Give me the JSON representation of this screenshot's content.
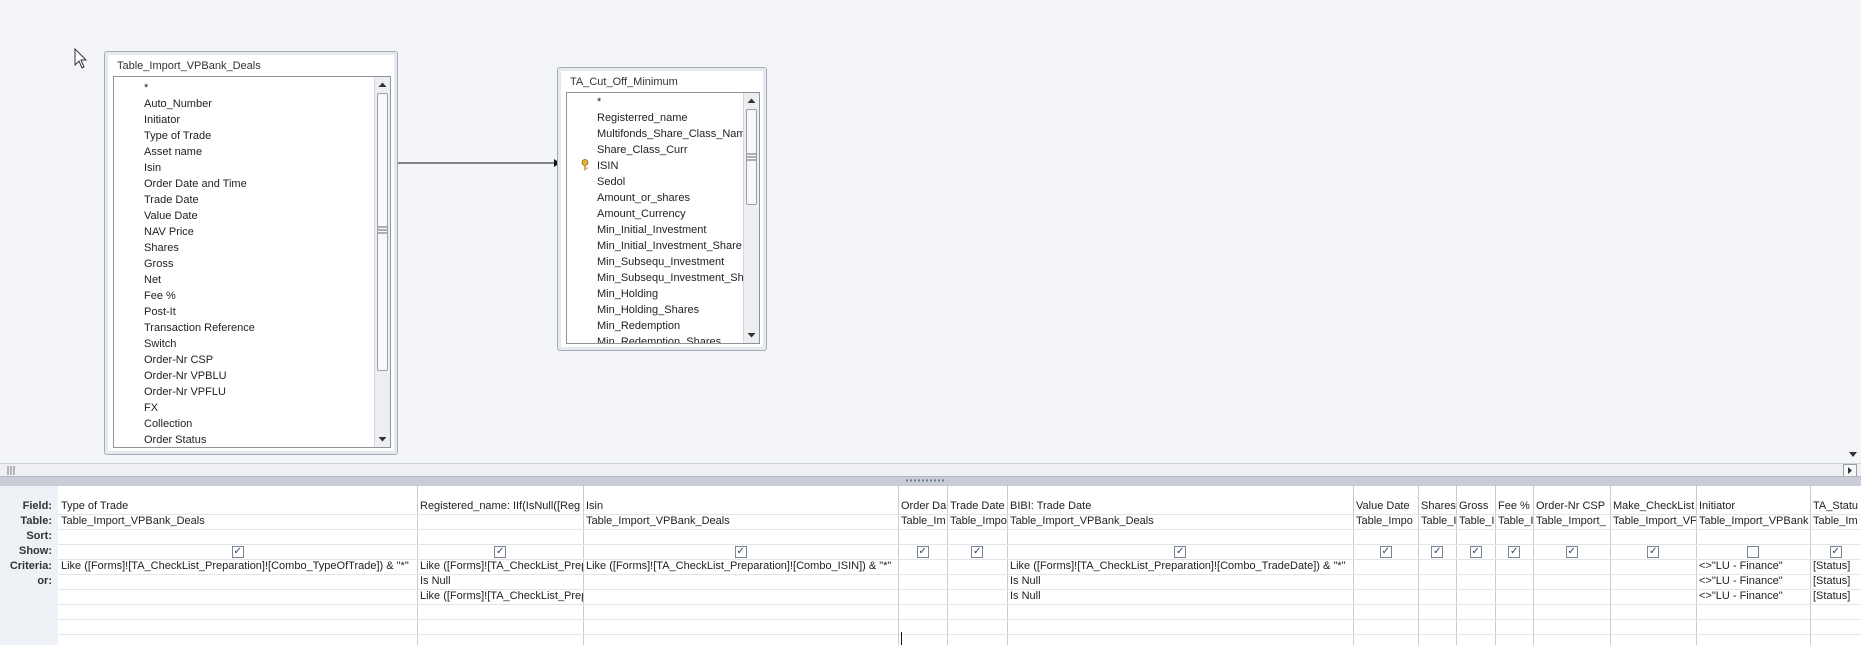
{
  "tables": {
    "left": {
      "title": "Table_Import_VPBank_Deals",
      "fields": [
        "*",
        "Auto_Number",
        "Initiator",
        "Type of Trade",
        "Asset name",
        "Isin",
        "Order Date and Time",
        "Trade Date",
        "Value Date",
        "NAV Price",
        "Shares",
        "Gross",
        "Net",
        "Fee %",
        "Post-It",
        "Transaction Reference",
        "Switch",
        "Order-Nr CSP",
        "Order-Nr VPBLU",
        "Order-Nr VPFLU",
        "FX",
        "Collection",
        "Order Status"
      ]
    },
    "right": {
      "title": "TA_Cut_Off_Minimum",
      "fields": [
        "*",
        "Registerred_name",
        "Multifonds_Share_Class_Nam",
        "Share_Class_Curr",
        "ISIN",
        "Sedol",
        "Amount_or_shares",
        "Amount_Currency",
        "Min_Initial_Investment",
        "Min_Initial_Investment_Share",
        "Min_Subsequ_Investment",
        "Min_Subsequ_Investment_Sh",
        "Min_Holding",
        "Min_Holding_Shares",
        "Min_Redemption",
        "Min_Redemption_Shares"
      ],
      "key_field": "ISIN"
    }
  },
  "row_labels": {
    "field": "Field:",
    "table": "Table:",
    "sort": "Sort:",
    "show": "Show:",
    "criteria": "Criteria:",
    "or": "or:"
  },
  "columns": [
    {
      "field": "Type of Trade",
      "table": "Table_Import_VPBank_Deals",
      "show": true,
      "criteria": "Like ([Forms]![TA_CheckList_Preparation]![Combo_TypeOfTrade]) & \"*\"",
      "or1": "",
      "or2": ""
    },
    {
      "field": "Registered_name: IIf(IsNull([Reg",
      "table": "",
      "show": true,
      "criteria": "Like ([Forms]![TA_CheckList_Prep",
      "or1": "Is Null",
      "or2": "Like ([Forms]![TA_CheckList_Prep"
    },
    {
      "field": "Isin",
      "table": "Table_Import_VPBank_Deals",
      "show": true,
      "criteria": "Like ([Forms]![TA_CheckList_Preparation]![Combo_ISIN]) & \"*\"",
      "or1": "",
      "or2": ""
    },
    {
      "field": "Order Da",
      "table": "Table_Im",
      "show": true,
      "criteria": "",
      "or1": "",
      "or2": ""
    },
    {
      "field": "Trade Date",
      "table": "Table_Impo",
      "show": true,
      "criteria": "",
      "or1": "",
      "or2": ""
    },
    {
      "field": "BIBI: Trade Date",
      "table": "Table_Import_VPBank_Deals",
      "show": true,
      "criteria": "Like ([Forms]![TA_CheckList_Preparation]![Combo_TradeDate]) & \"*\"",
      "or1": "Is Null",
      "or2": "Is Null"
    },
    {
      "field": "Value Date",
      "table": "Table_Impo",
      "show": true,
      "criteria": "",
      "or1": "",
      "or2": ""
    },
    {
      "field": "Shares",
      "table": "Table_I",
      "show": true,
      "criteria": "",
      "or1": "",
      "or2": ""
    },
    {
      "field": "Gross",
      "table": "Table_I",
      "show": true,
      "criteria": "",
      "or1": "",
      "or2": ""
    },
    {
      "field": "Fee %",
      "table": "Table_I",
      "show": true,
      "criteria": "",
      "or1": "",
      "or2": ""
    },
    {
      "field": "Order-Nr CSP",
      "table": "Table_Import_",
      "show": true,
      "criteria": "",
      "or1": "",
      "or2": ""
    },
    {
      "field": "Make_CheckList",
      "table": "Table_Import_VF",
      "show": true,
      "criteria": "",
      "or1": "",
      "or2": ""
    },
    {
      "field": "Initiator",
      "table": "Table_Import_VPBank",
      "show": false,
      "criteria": "<>\"LU - Finance\"",
      "or1": "<>\"LU - Finance\"",
      "or2": "<>\"LU - Finance\""
    },
    {
      "field": "TA_Statu",
      "table": "Table_Im",
      "show": true,
      "criteria": "[Status]",
      "or1": "[Status]",
      "or2": "[Status]"
    }
  ]
}
